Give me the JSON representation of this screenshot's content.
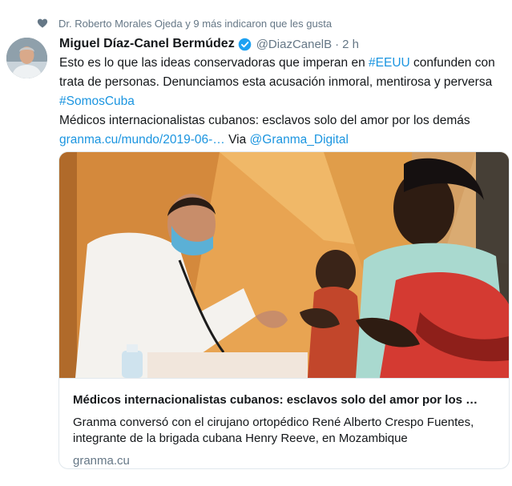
{
  "social_context": {
    "icon": "heart-icon",
    "text": "Dr. Roberto Morales Ojeda y 9 más indicaron que les gusta"
  },
  "tweet": {
    "author_name": "Miguel Díaz-Canel Bermúdez",
    "handle": "@DiazCanelB",
    "separator": "·",
    "time": "2 h",
    "text": {
      "l1_pre": "Esto es lo que las ideas conservadoras que imperan en ",
      "l1_link": "#EEUU",
      "l1_post": " confunden con",
      "l2": "trata de personas. Denunciamos esta  acusación inmoral, mentirosa y perversa",
      "l3_link": "#SomosCuba",
      "l4": "Médicos internacionalistas cubanos: esclavos solo del amor por los demás",
      "l5_link": "granma.cu/mundo/2019-06-…",
      "l5_via": " Via ",
      "l5_via_link": "@Granma_Digital"
    },
    "card": {
      "title": "Médicos internacionalistas cubanos: esclavos solo del amor por los …",
      "description": "Granma conversó con el cirujano ortopédico René Alberto Crespo Fuentes, integrante de la brigada cubana Henry Reeve, en Mozambique",
      "domain": "granma.cu"
    }
  },
  "colors": {
    "link": "#1b95e0",
    "verified": "#1da1f2",
    "secondary_text": "#657786",
    "border": "#e1e8ed"
  }
}
